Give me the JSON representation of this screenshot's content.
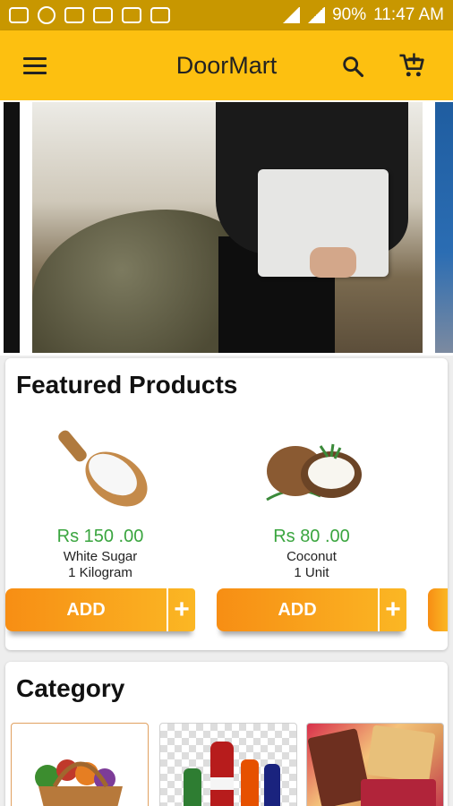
{
  "status_bar": {
    "battery": "90%",
    "time": "11:47 AM"
  },
  "app_bar": {
    "title": "DoorMart",
    "icons": [
      "menu-icon",
      "search-icon",
      "cart-add-icon"
    ]
  },
  "featured": {
    "title": "Featured Products",
    "products": [
      {
        "price": "Rs 150 .00",
        "name": "White Sugar",
        "unit": "1 Kilogram",
        "add_label": "ADD",
        "plus_label": "+",
        "image": "sugar-scoop-image"
      },
      {
        "price": "Rs 80 .00",
        "name": "Coconut",
        "unit": "1 Unit",
        "add_label": "ADD",
        "plus_label": "+",
        "image": "coconut-image"
      }
    ]
  },
  "category": {
    "title": "Category",
    "tiles": [
      "vegetable-basket-image",
      "beverage-bottles-image",
      "snack-packs-image"
    ]
  },
  "colors": {
    "appbar": "#fdc010",
    "statusbar": "#c89700",
    "price": "#3aa53f",
    "button_start": "#f78e14",
    "button_end": "#fbb724"
  }
}
